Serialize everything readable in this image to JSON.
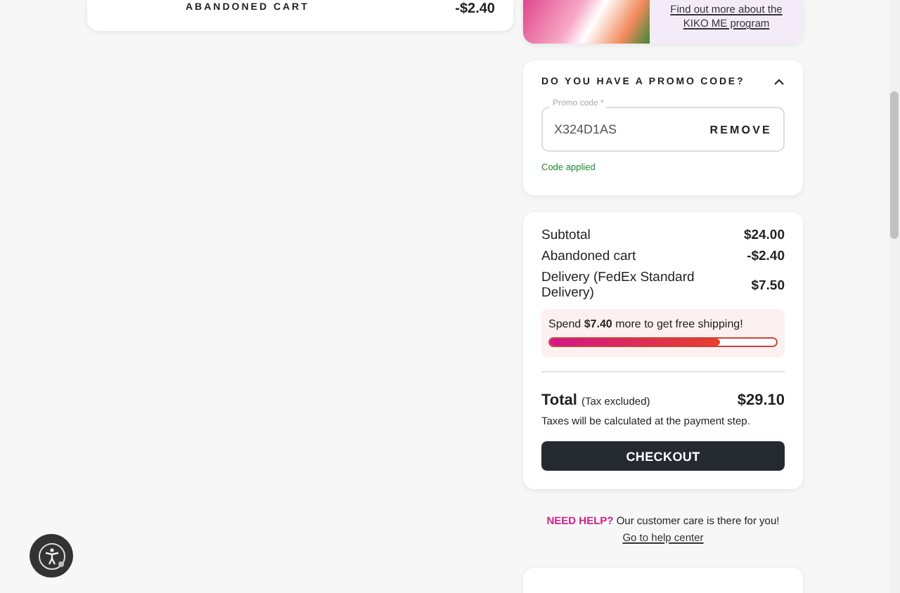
{
  "cart_card": {
    "label": "ABANDONED CART",
    "amount": "-$2.40"
  },
  "loyalty_banner": {
    "link": "Find out more about the KIKO ME program"
  },
  "promo": {
    "title": "DO YOU HAVE A PROMO CODE?",
    "expanded": true,
    "field_label": "Promo code *",
    "value": "X324D1AS",
    "action": "REMOVE",
    "status": "Code applied"
  },
  "summary": {
    "rows": [
      {
        "label": "Subtotal",
        "value": "$24.00"
      },
      {
        "label": "Abandoned cart",
        "value": "-$2.40"
      },
      {
        "label": "Delivery (FedEx Standard Delivery)",
        "value": "$7.50"
      }
    ],
    "shipping": {
      "message": "Spend **$7.40** more to get free shipping!",
      "level": 0.75
    },
    "total_label": "Total",
    "total_note": "(Tax excluded)",
    "total": "$29.10",
    "tax_note": "Taxes will be calculated at the payment step.",
    "checkout": "CHECKOUT"
  },
  "help": {
    "text": "**NEED HELP?** Our customer care is there for you!",
    "link": "Go to help center"
  }
}
